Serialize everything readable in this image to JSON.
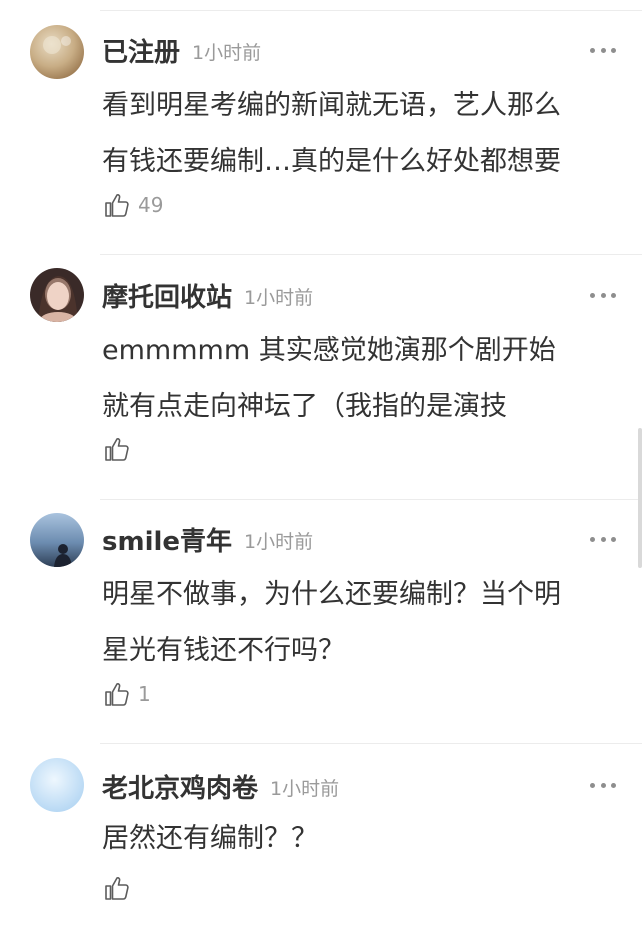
{
  "comments": [
    {
      "username": "已注册",
      "time": "1小时前",
      "text_lines": [
        "看到明星考编的新闻就无语，艺人那么",
        "有钱还要编制…真的是什么好处都想要"
      ],
      "likes": "49",
      "avatar_colors": [
        "#d8c8ac",
        "#a4865e"
      ]
    },
    {
      "username": "摩托回收站",
      "time": "1小时前",
      "text_lines": [
        "emmmmm 其实感觉她演那个剧开始",
        "就有点走向神坛了（我指的是演技"
      ],
      "likes": "",
      "avatar_colors": [
        "#6b4a3e",
        "#c9a79a"
      ]
    },
    {
      "username": "smile青年",
      "time": "1小时前",
      "text_lines": [
        "明星不做事，为什么还要编制？当个明",
        "星光有钱还不行吗？"
      ],
      "likes": "1",
      "avatar_colors": [
        "#9fb6d0",
        "#2f3f55"
      ]
    },
    {
      "username": "老北京鸡肉卷",
      "time": "1小时前",
      "text_lines": [
        "居然还有编制？？"
      ],
      "likes": "",
      "avatar_colors": [
        "#e3f1fc",
        "#b6d8f4"
      ]
    }
  ],
  "icons": {
    "like": "thumbs-up-icon",
    "more": "more-dots-icon"
  }
}
